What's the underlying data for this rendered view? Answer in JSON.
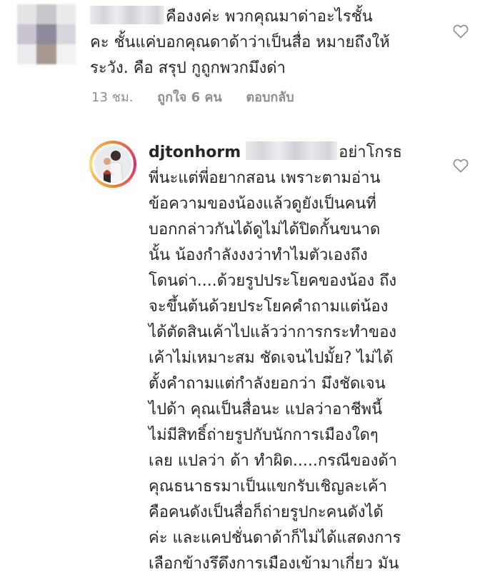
{
  "comment1": {
    "lines": [
      "คืองงค่ะ พวกคุณมาด่าอะไรชั้น",
      "คะ ชั้นแค่บอกคุณดาด้าว่าเป็นสื่อ หมายถึงให้",
      "ระวัง. คือ สรุป กูถูกพวกมึงด่า"
    ],
    "time": "13 ชม.",
    "likes": "ถูกใจ 6 คน",
    "reply": "ตอบกลับ"
  },
  "comment2": {
    "username": "djtonhorm",
    "lines": [
      "อย่าโกรธ",
      "พี่นะแต่พี่อยากสอน เพราะตามอ่าน",
      "ข้อความของน้องแล้วดูยังเป็นคนที่",
      "บอกกล่าวกันได้ดูไม่ได้ปิดกั้นขนาด",
      "นั้น น้องกำลังงงว่าทำไมตัวเองถึง",
      "โดนด่า....ด้วยรูปประโยคของน้อง ถึง",
      "จะขึ้นต้นด้วยประโยคคำถามแต่น้อง",
      "ได้ตัดสินเค้าไปแล้วว่าการกระทำของ",
      "เค้าไม่เหมาะสม ชัดเจนไปมั้ย? ไม่ได้",
      "ตั้งคำถามแต่กำลังยอกว่า มึงชัดเจน",
      "ไปด้า คุณเป็นสื่อนะ แปลว่าอาชีพนี้",
      "ไม่มีสิทธิ์ถ่ายรูปกับนักการเมืองใดๆ",
      "เลย แปลว่า ด้า ทำผิด.....กรณีของด้า",
      "คุณธนาธรมาเป็นแขกรับเชิญละเค้า",
      "คือคนดังเป็นสื่อก็ถ่ายรูปกะคนดังได้",
      "ค่ะ และแคปชั่นดาด้าก็ไม่ได้แสดงการ",
      "เลือกข้างรึดึงการเมืองเข้ามาเกี่ยว มัน"
    ]
  },
  "colors": {
    "text": "#262626",
    "meta": "#8e8e8e",
    "heart": "#8e8e8e",
    "ring_start": "#f58529",
    "ring_end": "#dd2a7b"
  },
  "icons": {
    "like": "heart-outline-icon"
  }
}
